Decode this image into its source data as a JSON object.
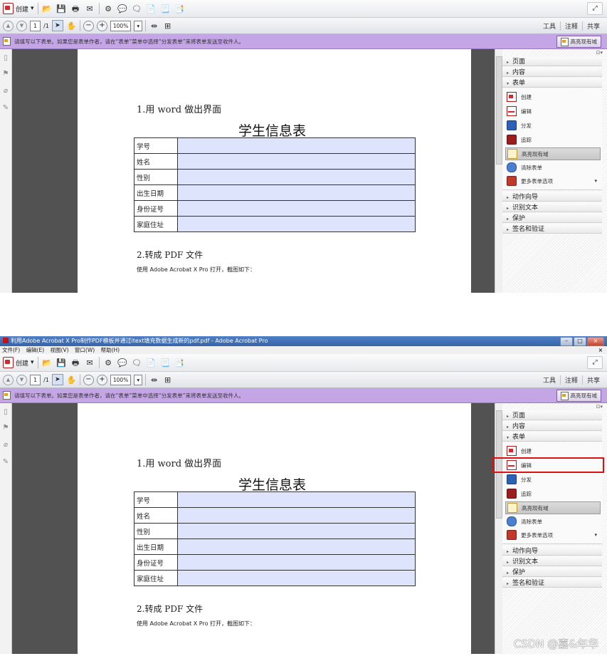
{
  "title_bar": {
    "text": "利用Adobe Acrobat X Pro制作PDF模板并通过itext填充数据生成新的pdf.pdf - Adobe Acrobat Pro"
  },
  "menubar": {
    "items": [
      "文件(F)",
      "编辑(E)",
      "视图(V)",
      "窗口(W)",
      "帮助(H)"
    ],
    "close": "×"
  },
  "toolbar": {
    "create_label": "创建",
    "create_arrow": "▾",
    "page_current": "1",
    "page_total": "/1",
    "zoom": "100%",
    "zoom_arrow": "▾",
    "tools_label": "工具",
    "comment_label": "注释",
    "share_label": "共享"
  },
  "form_bar": {
    "message": "请填写以下表单。如果您是表单作者，请在“表单”菜单中选择“分发表单”来将表单发送至收件人。",
    "highlight_button": "高亮现有域"
  },
  "document": {
    "heading1": "1.用 word 做出界面",
    "title": "学生信息表",
    "fields": [
      "学号",
      "姓名",
      "性别",
      "出生日期",
      "身份证号",
      "家庭住址"
    ],
    "heading2": "2.转成 PDF 文件",
    "description": "使用 Adobe Acrobat X Pro 打开，截图如下："
  },
  "tools_pane": {
    "top_control": "⊡▾",
    "sections_before": [
      "页面",
      "内容"
    ],
    "forms_section": "表单",
    "form_items": [
      "创建",
      "编辑",
      "分发",
      "追踪",
      "高亮现有域",
      "清除表单",
      "更多表单选项"
    ],
    "sections_after": [
      "动作向导",
      "识别文本",
      "保护",
      "签名和验证"
    ]
  },
  "watermark": "CSDN @嘉&年华",
  "colors": {
    "form_bar": "#c4a5e6",
    "field_fill": "#dde4fc",
    "page_bg": "#525252",
    "highlight_box": "#dd1111"
  }
}
